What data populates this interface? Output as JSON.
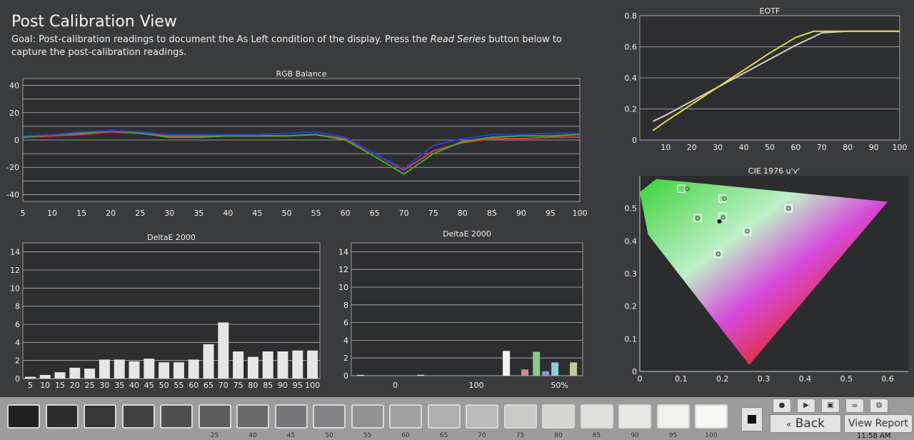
{
  "page": {
    "title": "Post Calibration View",
    "goal_prefix": "Goal: Post-calibration readings to document the As Left condition of the display. Press the ",
    "goal_emphasis": "Read Series",
    "goal_suffix": " button below to capture the post-calibration readings."
  },
  "chart_data": [
    {
      "type": "line",
      "title": "RGB Balance",
      "x": [
        5,
        10,
        15,
        20,
        25,
        30,
        35,
        40,
        45,
        50,
        55,
        60,
        65,
        70,
        75,
        80,
        85,
        90,
        95,
        100
      ],
      "xticks": [
        "5",
        "10",
        "15",
        "20",
        "25",
        "30",
        "35",
        "40",
        "45",
        "50",
        "55",
        "60",
        "65",
        "70",
        "75",
        "80",
        "85",
        "90",
        "95",
        "100"
      ],
      "ylim": [
        -45,
        45
      ],
      "yticks": [
        40,
        20,
        0,
        -20,
        -40
      ],
      "series": [
        {
          "color": "#e03a3a",
          "values": [
            2,
            3,
            4,
            6,
            5,
            3,
            3,
            3,
            3,
            3,
            4,
            1,
            -10,
            -22,
            -8,
            -2,
            1,
            1,
            2,
            2
          ]
        },
        {
          "color": "#3fae3a",
          "values": [
            2,
            4,
            5,
            7,
            5,
            2,
            2,
            3,
            3,
            3,
            4,
            0,
            -12,
            -25,
            -10,
            -1,
            2,
            3,
            3,
            4
          ]
        },
        {
          "color": "#2a3ad8",
          "values": [
            3,
            4,
            6,
            7,
            6,
            4,
            4,
            4,
            4,
            5,
            6,
            2,
            -10,
            -21,
            -4,
            1,
            4,
            4,
            5,
            5
          ]
        }
      ],
      "grid": true
    },
    {
      "type": "bar",
      "title": "DeltaE 2000",
      "categories": [
        "5",
        "10",
        "15",
        "20",
        "25",
        "30",
        "35",
        "40",
        "45",
        "50",
        "55",
        "60",
        "65",
        "70",
        "75",
        "80",
        "85",
        "90",
        "95",
        "100"
      ],
      "values": [
        0.2,
        0.4,
        0.7,
        1.2,
        1.1,
        2.1,
        2.1,
        1.9,
        2.2,
        1.8,
        1.8,
        2.1,
        3.8,
        6.2,
        3.0,
        2.4,
        3.0,
        3.0,
        3.1,
        3.1
      ],
      "ylim": [
        0,
        15
      ],
      "yticks": [
        14,
        12,
        10,
        8,
        6,
        4,
        2,
        0
      ],
      "bar_color": "#e6e6e6",
      "grid": true
    },
    {
      "type": "bar",
      "title": "DeltaE 2000",
      "xticks": [
        {
          "label": "0",
          "pos": 0.19
        },
        {
          "label": "100",
          "pos": 0.54
        },
        {
          "label": "50%",
          "pos": 0.9
        }
      ],
      "bars": [
        {
          "pos": 0.04,
          "value": 0.1,
          "color": "#dddddd"
        },
        {
          "pos": 0.3,
          "value": 0.1,
          "color": "#dddddd"
        },
        {
          "pos": 0.67,
          "value": 2.8,
          "color": "#f2f2f2"
        },
        {
          "pos": 0.75,
          "value": 0.7,
          "color": "#d88a8a"
        },
        {
          "pos": 0.8,
          "value": 2.7,
          "color": "#8cc98a"
        },
        {
          "pos": 0.84,
          "value": 0.5,
          "color": "#8a98d8"
        },
        {
          "pos": 0.88,
          "value": 1.5,
          "color": "#8ad0d8"
        },
        {
          "pos": 0.96,
          "value": 1.5,
          "color": "#c8c89a"
        }
      ],
      "ylim": [
        0,
        15
      ],
      "yticks": [
        14,
        12,
        10,
        8,
        6,
        4,
        2,
        0
      ],
      "grid": true
    },
    {
      "type": "line",
      "title": "EOTF",
      "x": [
        5,
        10,
        20,
        30,
        40,
        50,
        60,
        67,
        70,
        80,
        90,
        100
      ],
      "xticks": [
        "10",
        "20",
        "30",
        "40",
        "50",
        "60",
        "70",
        "80",
        "90",
        "100"
      ],
      "ylim": [
        0,
        0.8
      ],
      "yticks": [
        "0.8",
        "0.6",
        "0.4",
        "0.2",
        "0"
      ],
      "series": [
        {
          "color": "#d8d0c0",
          "values": [
            0.12,
            0.16,
            0.25,
            0.34,
            0.43,
            0.52,
            0.61,
            0.665,
            0.69,
            0.7,
            0.7,
            0.7
          ]
        },
        {
          "color": "#e6d84a",
          "values": [
            0.06,
            0.12,
            0.23,
            0.34,
            0.45,
            0.56,
            0.66,
            0.7,
            0.7,
            0.7,
            0.7,
            0.7
          ]
        }
      ],
      "grid": true
    },
    {
      "type": "scatter",
      "title": "CIE 1976 u'v'",
      "xlim": [
        0,
        0.65
      ],
      "ylim": [
        0,
        0.6
      ],
      "xticks": [
        "0",
        "0.1",
        "0.2",
        "0.3",
        "0.4",
        "0.5",
        "0.6"
      ],
      "yticks": [
        "0.5",
        "0.4",
        "0.3",
        "0.2",
        "0.1",
        "0"
      ],
      "targets": [
        {
          "u": 0.1,
          "v": 0.56
        },
        {
          "u": 0.2,
          "v": 0.53
        },
        {
          "u": 0.36,
          "v": 0.5
        },
        {
          "u": 0.14,
          "v": 0.47
        },
        {
          "u": 0.2,
          "v": 0.475
        },
        {
          "u": 0.26,
          "v": 0.43
        },
        {
          "u": 0.19,
          "v": 0.36
        }
      ],
      "measured": [
        {
          "u": 0.115,
          "v": 0.56
        },
        {
          "u": 0.205,
          "v": 0.53
        },
        {
          "u": 0.36,
          "v": 0.5
        },
        {
          "u": 0.14,
          "v": 0.47
        },
        {
          "u": 0.202,
          "v": 0.472
        },
        {
          "u": 0.26,
          "v": 0.43
        },
        {
          "u": 0.19,
          "v": 0.36
        }
      ],
      "whitepoint": {
        "u": 0.193,
        "v": 0.46
      },
      "gamut": [
        [
          0.265,
          0.02
        ],
        [
          0.6,
          0.52
        ],
        [
          0.04,
          0.59
        ],
        [
          0.0,
          0.55
        ],
        [
          0.02,
          0.42
        ]
      ]
    }
  ],
  "swatches": [
    {
      "label": "",
      "color": "#1f2022"
    },
    {
      "label": "",
      "color": "#2a2b2d"
    },
    {
      "label": "",
      "color": "#353638"
    },
    {
      "label": "",
      "color": "#404143"
    },
    {
      "label": "",
      "color": "#4d4e50"
    },
    {
      "label": "25",
      "color": "#5a5b5d"
    },
    {
      "label": "40",
      "color": "#68696b"
    },
    {
      "label": "45",
      "color": "#75767a"
    },
    {
      "label": "50",
      "color": "#828386"
    },
    {
      "label": "55",
      "color": "#909294"
    },
    {
      "label": "60",
      "color": "#9fa0a2"
    },
    {
      "label": "65",
      "color": "#adaeae"
    },
    {
      "label": "70",
      "color": "#bbbcbb"
    },
    {
      "label": "75",
      "color": "#c9c9c6"
    },
    {
      "label": "80",
      "color": "#d6d6d2"
    },
    {
      "label": "85",
      "color": "#e0e0dc"
    },
    {
      "label": "90",
      "color": "#e9e9e6"
    },
    {
      "label": "95",
      "color": "#f1f1ee"
    },
    {
      "label": "100",
      "color": "#f8f8f5"
    }
  ],
  "controls": {
    "back_label": "Back",
    "view_report_label": "View Report",
    "clock": "11:58 AM"
  }
}
